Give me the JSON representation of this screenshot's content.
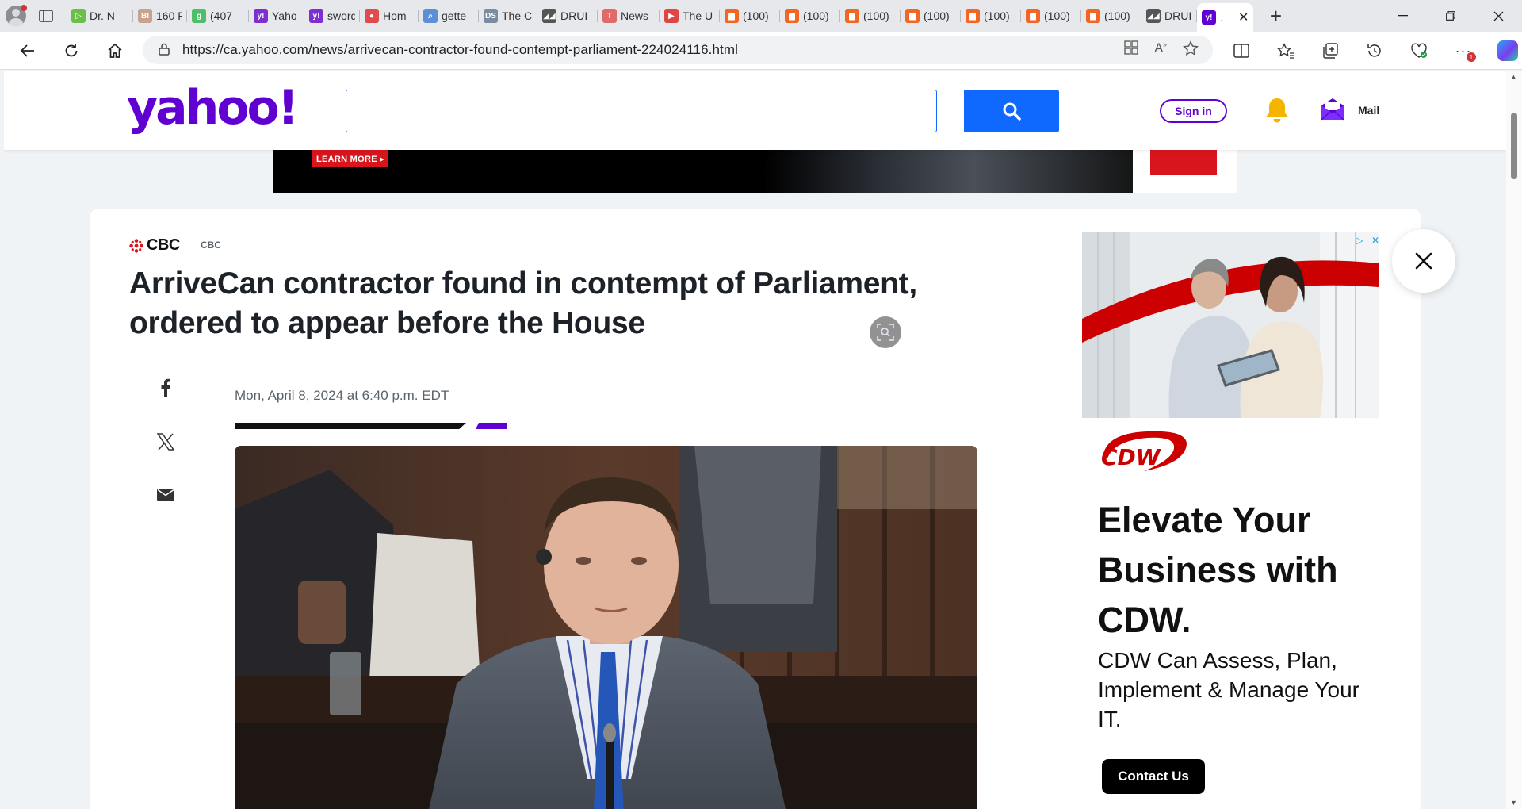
{
  "browser": {
    "tabs": [
      {
        "title": "Dr. N",
        "color": "#6abf4b",
        "glyph": "▷"
      },
      {
        "title": "160 F",
        "color": "#c8a28a",
        "glyph": "BI"
      },
      {
        "title": "(407",
        "color": "#4fbe6a",
        "glyph": "g"
      },
      {
        "title": "Yaho",
        "color": "#7e2fd1",
        "glyph": "y!"
      },
      {
        "title": "sword",
        "color": "#7e2fd1",
        "glyph": "y!"
      },
      {
        "title": "Hom",
        "color": "#e04b4b",
        "glyph": "●"
      },
      {
        "title": "gette",
        "color": "#5d8fd6",
        "glyph": "⌕"
      },
      {
        "title": "The C",
        "color": "#7a8ca0",
        "glyph": "DS"
      },
      {
        "title": "DRUI",
        "color": "#555555",
        "glyph": "◢◢"
      },
      {
        "title": "News",
        "color": "#e06a6a",
        "glyph": "T"
      },
      {
        "title": "The U",
        "color": "#e04545",
        "glyph": "▶"
      },
      {
        "title": "(100)",
        "color": "#f26522",
        "glyph": "▆"
      },
      {
        "title": "(100)",
        "color": "#f26522",
        "glyph": "▆"
      },
      {
        "title": "(100)",
        "color": "#f26522",
        "glyph": "▆"
      },
      {
        "title": "(100)",
        "color": "#f26522",
        "glyph": "▆"
      },
      {
        "title": "(100)",
        "color": "#f26522",
        "glyph": "▆"
      },
      {
        "title": "(100)",
        "color": "#f26522",
        "glyph": "▆"
      },
      {
        "title": "(100)",
        "color": "#f26522",
        "glyph": "▆"
      },
      {
        "title": "DRUI",
        "color": "#555555",
        "glyph": "◢◢"
      }
    ],
    "active_tab": {
      "title": ".",
      "color": "#6001d2",
      "glyph": "y!"
    },
    "url": "https://ca.yahoo.com/news/arrivecan-contractor-found-contempt-parliament-224024116.html"
  },
  "yahoo": {
    "logo": "yahoo!",
    "search_placeholder": "",
    "signin_label": "Sign in",
    "mail_label": "Mail"
  },
  "top_ad": {
    "cta": "LEARN MORE ▸"
  },
  "article": {
    "source_logo": "CBC",
    "provider": "CBC",
    "headline": "ArriveCan contractor found in contempt of Parliament, ordered to appear before the House",
    "date": "Mon, April 8, 2024 at 6:40 p.m. EDT"
  },
  "side_ad": {
    "brand": "CDW",
    "headline": "Elevate Your Business with CDW.",
    "body": "CDW Can Assess, Plan, Implement & Manage Your IT.",
    "cta": "Contact Us"
  },
  "colors": {
    "yahoo_purple": "#6001d2",
    "search_blue": "#0f69ff",
    "cdw_red": "#cc0000",
    "bell_yellow": "#f5b400"
  }
}
